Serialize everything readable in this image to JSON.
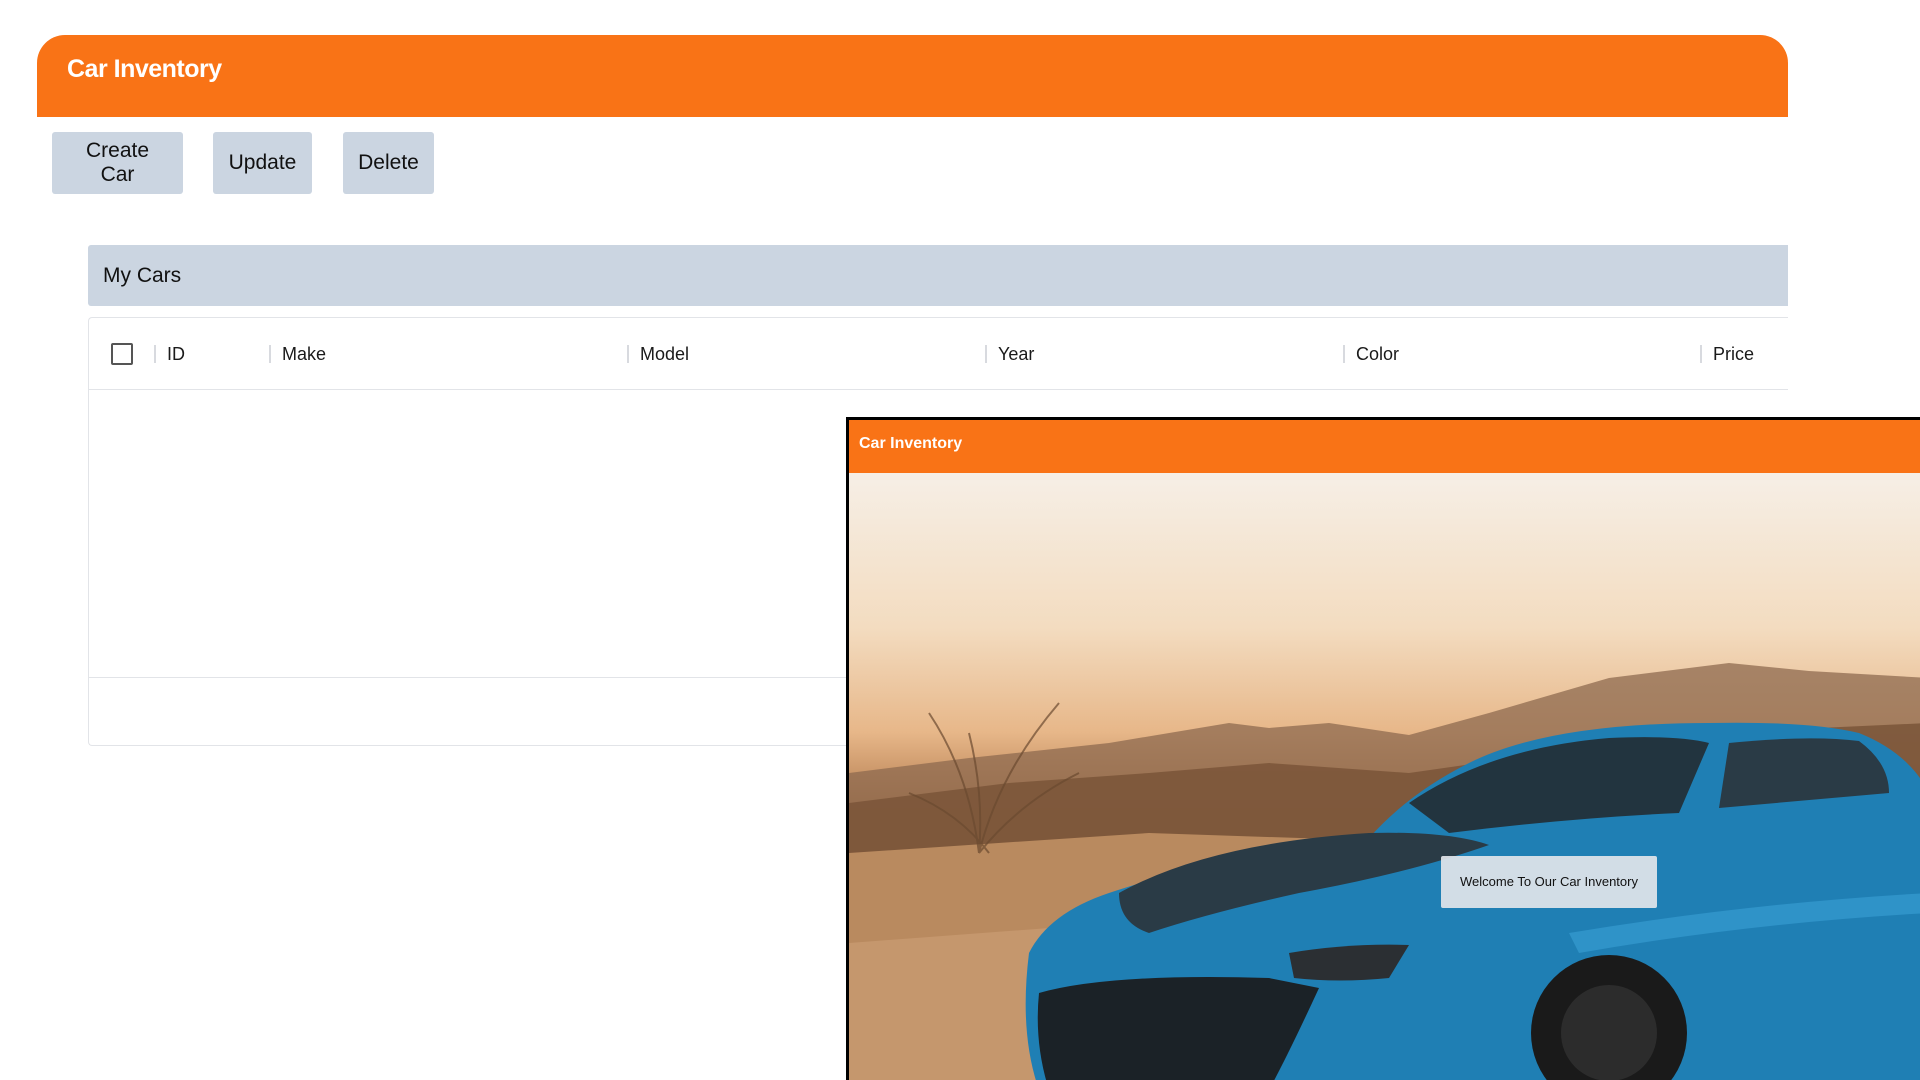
{
  "app": {
    "title": "Car Inventory"
  },
  "toolbar": {
    "create_label": "Create Car",
    "update_label": "Update",
    "delete_label": "Delete"
  },
  "panel": {
    "title": "My Cars"
  },
  "table": {
    "columns": [
      "ID",
      "Make",
      "Model",
      "Year",
      "Color",
      "Price"
    ],
    "rows": []
  },
  "overlay": {
    "title": "Car Inventory",
    "welcome_text": "Welcome To Our Car Inventory"
  },
  "colors": {
    "accent": "#f97316",
    "button_bg": "#cbd5e1",
    "car_body": "#1f7fb4"
  },
  "icons": {
    "checkbox": "checkbox-icon"
  }
}
